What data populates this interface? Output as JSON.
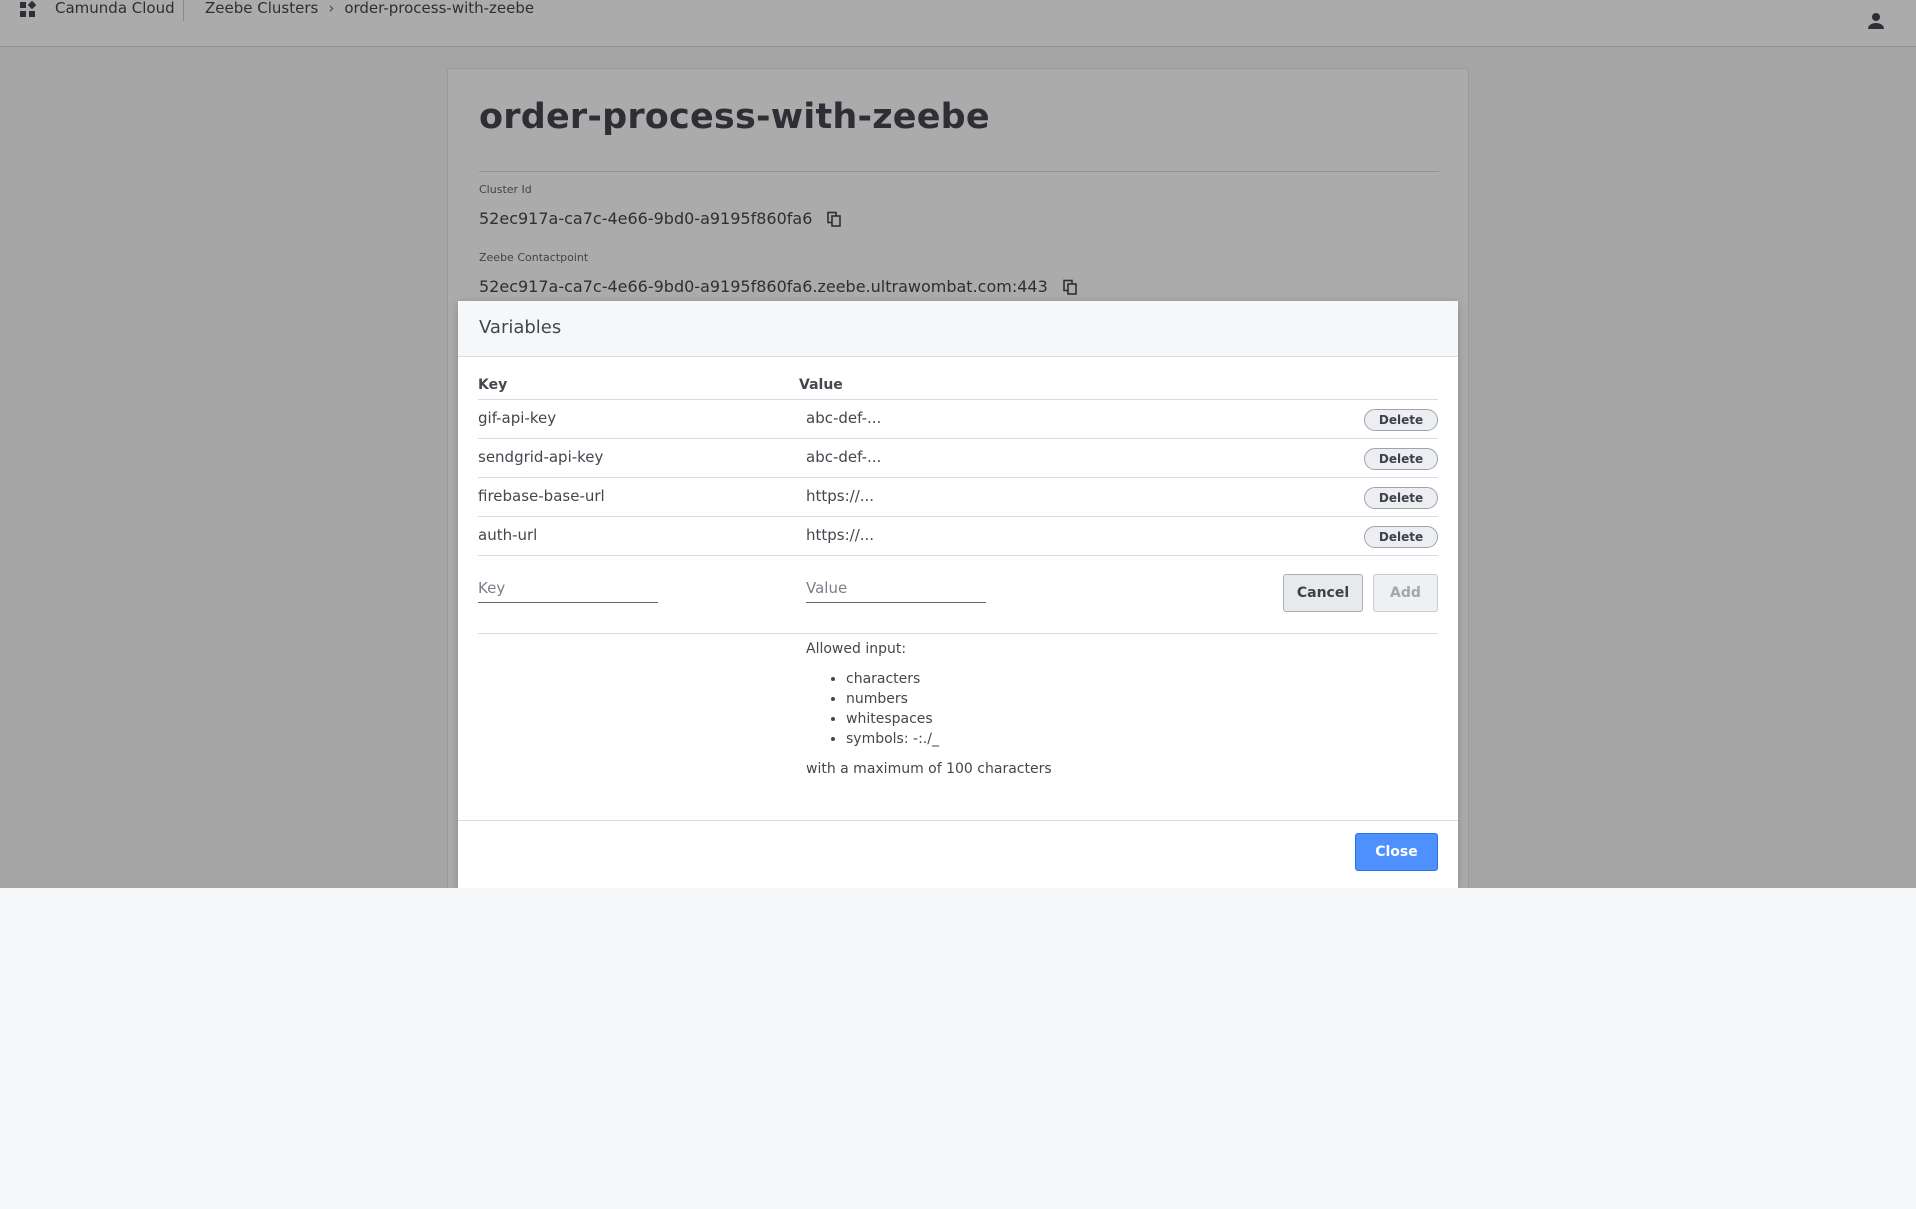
{
  "header": {
    "brand": "Camunda Cloud",
    "breadcrumb": [
      "Zeebe Clusters",
      "order-process-with-zeebe"
    ],
    "breadcrumb_separator": "›"
  },
  "cluster": {
    "title": "order-process-with-zeebe",
    "cluster_id_label": "Cluster Id",
    "cluster_id": "52ec917a-ca7c-4e66-9bd0-a9195f860fa6",
    "contactpoint_label": "Zeebe Contactpoint",
    "contactpoint": "52ec917a-ca7c-4e66-9bd0-a9195f860fa6.zeebe.ultrawombat.com:443"
  },
  "modal": {
    "title": "Variables",
    "columns": {
      "key": "Key",
      "value": "Value"
    },
    "rows": [
      {
        "key": "gif-api-key",
        "value": "abc-def-...",
        "action": "Delete"
      },
      {
        "key": "sendgrid-api-key",
        "value": "abc-def-...",
        "action": "Delete"
      },
      {
        "key": "firebase-base-url",
        "value": "https://...",
        "action": "Delete"
      },
      {
        "key": "auth-url",
        "value": "https://...",
        "action": "Delete"
      }
    ],
    "new_row": {
      "key_placeholder": "Key",
      "value_placeholder": "Value",
      "cancel_label": "Cancel",
      "add_label": "Add"
    },
    "help": {
      "intro": "Allowed input:",
      "items": [
        "characters",
        "numbers",
        "whitespaces",
        "symbols: -:./_"
      ],
      "limit": "with a maximum of 100 characters"
    },
    "close_label": "Close"
  },
  "colors": {
    "primary": "#4d90fe",
    "text": "#45464e",
    "overlay": "rgba(0,0,0,0.33)"
  }
}
